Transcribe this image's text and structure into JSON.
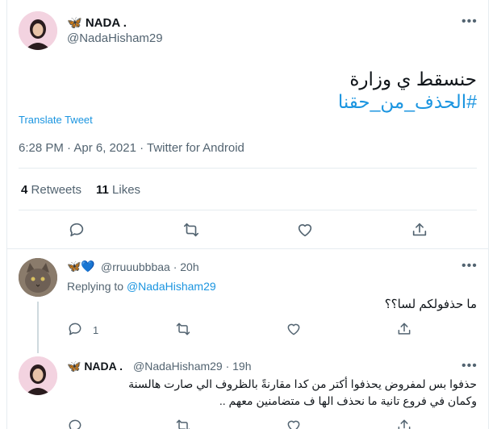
{
  "main_tweet": {
    "display_name": "🦋 NADA .",
    "handle": "@NadaHisham29",
    "text": "حنسقط ي وزارة",
    "hashtag": "#الحذف_من_حقنا",
    "translate": "Translate Tweet",
    "meta": "6:28 PM · Apr 6, 2021 · Twitter for Android",
    "retweets_count": "4",
    "retweets_label": "Retweets",
    "likes_count": "11",
    "likes_label": "Likes"
  },
  "reply": {
    "display_name": "🦋💙",
    "handle_time": "@rruuubbbaa · 20h",
    "replying_to_label": "Replying to",
    "replying_to_handle": "@NadaHisham29",
    "text": "ما حذفولكم لسا؟؟",
    "reply_count": "1"
  },
  "reply2": {
    "display_name": "🦋 NADA .",
    "handle_time": "@NadaHisham29 · 19h",
    "text_line1": "حذفوا بس لمفروض يحذفوا أكتر من كدا مقارنةً بالظروف الي صارت هالسنة",
    "text_line2": "وكمان في فروع تانية ما نحذف الها ف متضامنين معهم .."
  },
  "colors": {
    "accent": "#1b95e0",
    "muted": "#536471",
    "border": "#e6ecf0"
  }
}
